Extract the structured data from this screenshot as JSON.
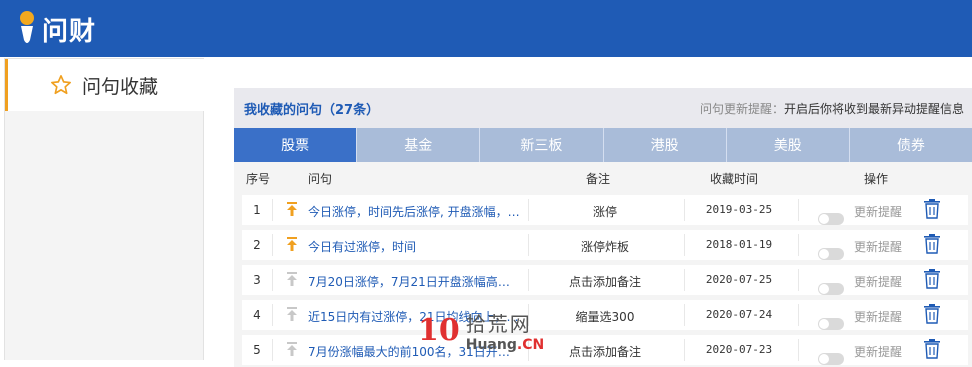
{
  "header": {
    "app_name": "问财"
  },
  "sidebar": {
    "item_label": "问句收藏"
  },
  "panel": {
    "title": "我收藏的问句（27条）",
    "notice_label": "问句更新提醒：",
    "notice_text": "开启后你将收到最新异动提醒信息"
  },
  "tabs": [
    "股票",
    "基金",
    "新三板",
    "港股",
    "美股",
    "债券"
  ],
  "active_tab": "股票",
  "table": {
    "headers": {
      "no": "序号",
      "question": "问句",
      "note": "备注",
      "time": "收藏时间",
      "action": "操作"
    },
    "rows": [
      {
        "no": "1",
        "question": "今日涨停，时间先后涨停, 开盘涨幅，…",
        "note": "涨停",
        "date": "2019-03-25",
        "update": "更新提醒",
        "pinned": true
      },
      {
        "no": "2",
        "question": "今日有过涨停，时间",
        "note": "涨停炸板",
        "date": "2018-01-19",
        "update": "更新提醒",
        "pinned": true
      },
      {
        "no": "3",
        "question": "7月20日涨停，7月21日开盘涨幅高于7…",
        "note": "点击添加备注",
        "date": "2020-07-25",
        "update": "更新提醒",
        "pinned": false
      },
      {
        "no": "4",
        "question": "近15日内有过涨停，21日均线向上，…",
        "note": "缩量选300",
        "date": "2020-07-24",
        "update": "更新提醒",
        "pinned": false
      },
      {
        "no": "5",
        "question": "7月份涨幅最大的前100名，31日开盘…",
        "note": "点击添加备注",
        "date": "2020-07-23",
        "update": "更新提醒",
        "pinned": false
      }
    ]
  },
  "watermark": {
    "ten": "10",
    "cn": "拾荒网",
    "en_prefix": "Huang",
    "en_suffix": ".CN"
  },
  "colors": {
    "brand_blue": "#1f5bb5",
    "tab_active": "#3a70c8",
    "tab_inactive": "#a9bcd9",
    "pin_active": "#f0a020",
    "pin_inactive": "#c8c8c8"
  }
}
